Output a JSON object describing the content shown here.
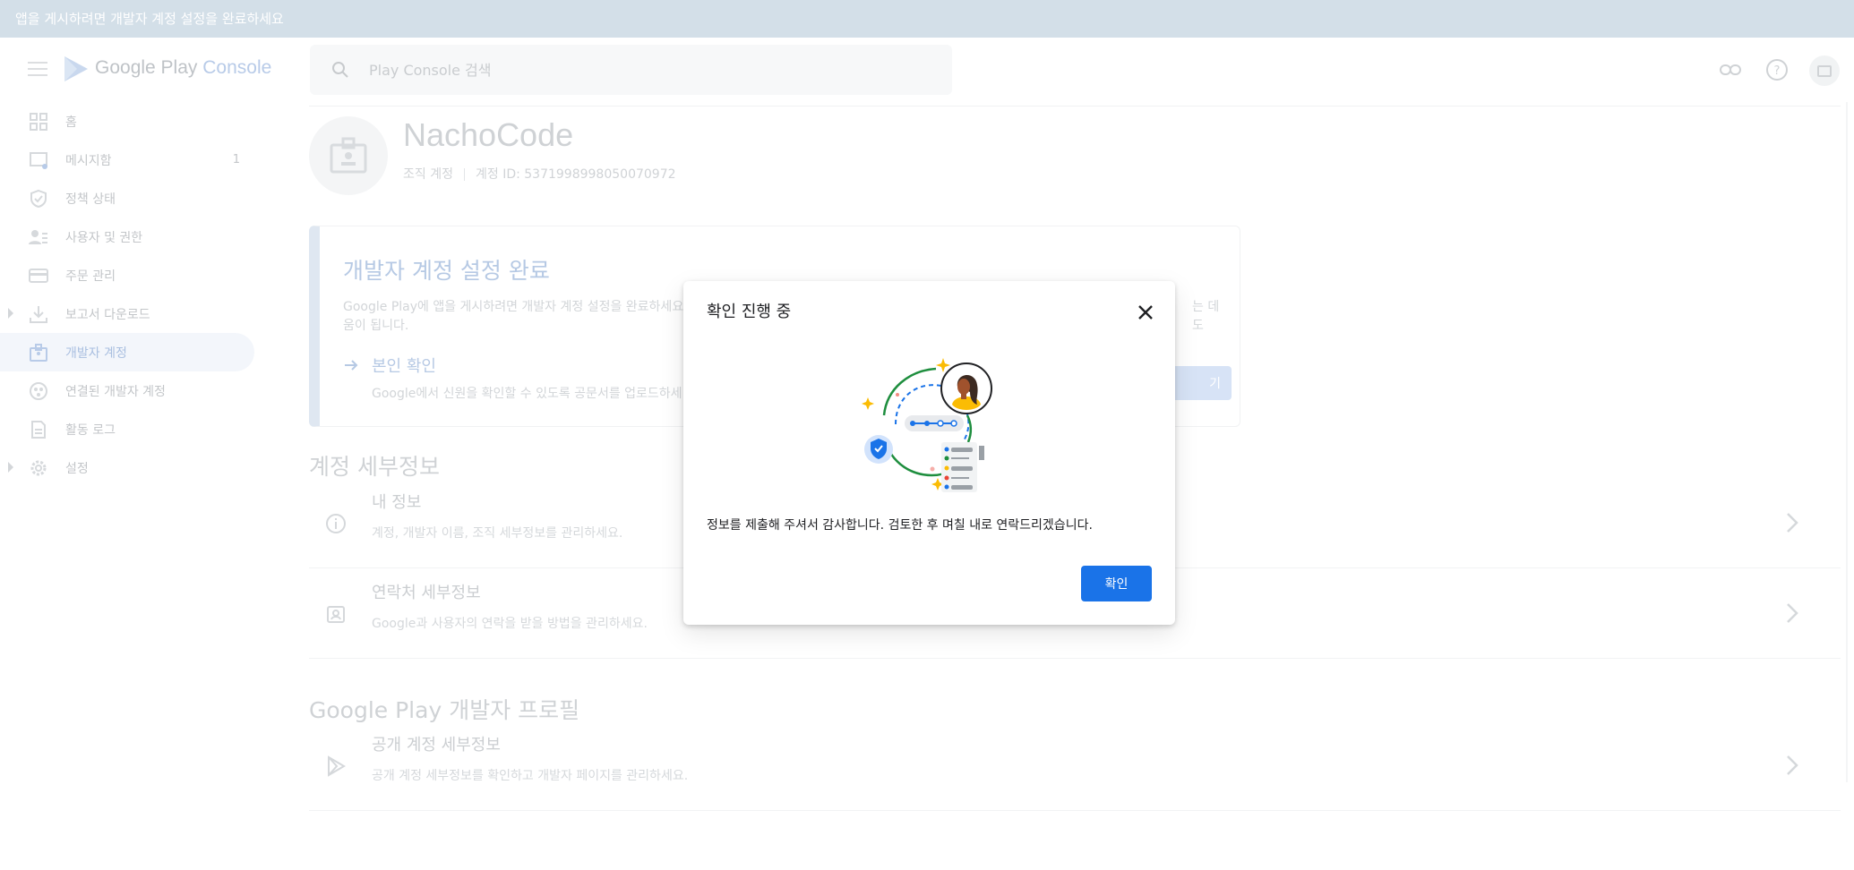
{
  "banner": {
    "text": "앱을 게시하려면 개발자 계정 설정을 완료하세요"
  },
  "header": {
    "logo_google": "Google Play",
    "logo_console": "Console",
    "search_placeholder": "Play Console 검색"
  },
  "sidebar": {
    "items": [
      {
        "label": "홈",
        "icon": "home-grid-icon"
      },
      {
        "label": "메시지함",
        "icon": "inbox-icon",
        "badge": "1"
      },
      {
        "label": "정책 상태",
        "icon": "shield-icon"
      },
      {
        "label": "사용자 및 권한",
        "icon": "users-icon"
      },
      {
        "label": "주문 관리",
        "icon": "credit-card-icon"
      },
      {
        "label": "보고서 다운로드",
        "icon": "download-icon"
      },
      {
        "label": "개발자 계정",
        "icon": "badge-icon"
      },
      {
        "label": "연결된 개발자 계정",
        "icon": "linked-accounts-icon"
      },
      {
        "label": "활동 로그",
        "icon": "document-icon"
      },
      {
        "label": "설정",
        "icon": "gear-icon"
      }
    ]
  },
  "account": {
    "name": "NachoCode",
    "type": "조직 계정",
    "id_label": "계정 ID: 5371998998050070972"
  },
  "setup": {
    "title": "개발자 계정 설정 완료",
    "desc_line1": "Google Play에 앱을 게시하려면 개발자 계정 설정을 완료하세요",
    "desc_tail": "는 데 도",
    "desc_line2": "움이 됩니다.",
    "step_label": "본인 확인",
    "step_desc": "Google에서 신원을 확인할 수 있도록 공문서를 업로드하세",
    "button": "기"
  },
  "details": {
    "section_title": "계정 세부정보",
    "rows": [
      {
        "title": "내 정보",
        "desc": "계정, 개발자 이름, 조직 세부정보를 관리하세요."
      },
      {
        "title": "연락처 세부정보",
        "desc": "Google과 사용자의 연락을 받을 방법을 관리하세요."
      }
    ]
  },
  "profile": {
    "section_title": "Google Play 개발자 프로필",
    "rows": [
      {
        "title": "공개 계정 세부정보",
        "desc": "공개 계정 세부정보를 확인하고 개발자 페이지를 관리하세요."
      }
    ]
  },
  "dialog": {
    "title": "확인 진행 중",
    "message": "정보를 제출해 주셔서 감사합니다. 검토한 후 며칠 내로 연락드리겠습니다.",
    "ok_label": "확인"
  },
  "colors": {
    "primary": "#1a73e8",
    "banner_bg": "#d3dfe8",
    "illustration_green": "#1e8e3e",
    "illustration_yellow": "#fbbc04",
    "illustration_blue": "#1a73e8"
  }
}
